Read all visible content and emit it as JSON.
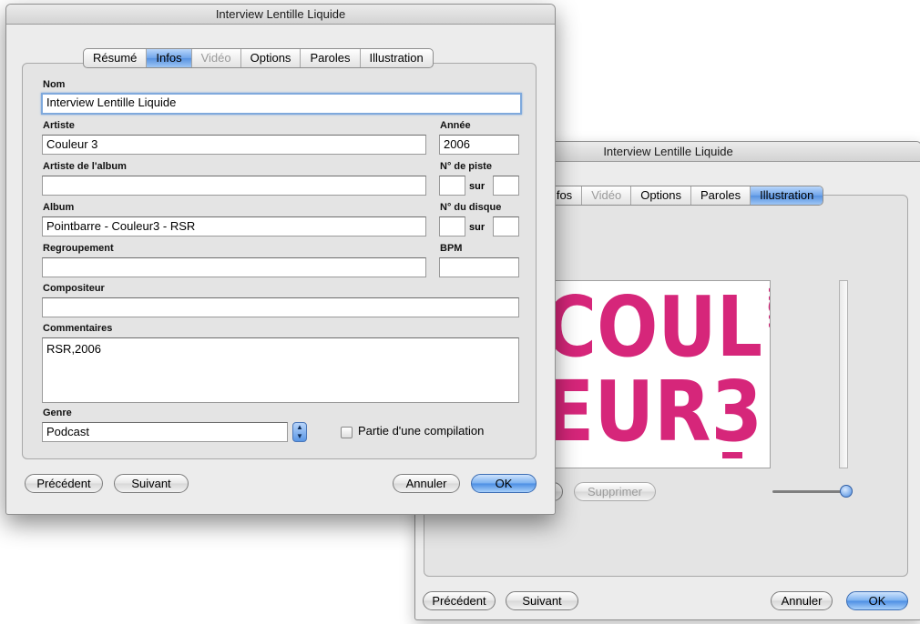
{
  "back_window": {
    "title": "Interview Lentille Liquide",
    "tabs": [
      {
        "label": "Infos",
        "state": "normal"
      },
      {
        "label": "Vidéo",
        "state": "disabled"
      },
      {
        "label": "Options",
        "state": "normal"
      },
      {
        "label": "Paroles",
        "state": "normal"
      },
      {
        "label": "Illustration",
        "state": "active"
      }
    ],
    "artwork_text": {
      "top": "COUL",
      "bottom": "EUR3",
      "side": "RSR"
    },
    "delete_label": "Supprimer",
    "prev_label": "Précédent",
    "next_label": "Suivant",
    "cancel_label": "Annuler",
    "ok_label": "OK"
  },
  "front_window": {
    "title": "Interview Lentille Liquide",
    "tabs": [
      {
        "label": "Résumé",
        "state": "normal"
      },
      {
        "label": "Infos",
        "state": "active"
      },
      {
        "label": "Vidéo",
        "state": "disabled"
      },
      {
        "label": "Options",
        "state": "normal"
      },
      {
        "label": "Paroles",
        "state": "normal"
      },
      {
        "label": "Illustration",
        "state": "normal"
      }
    ],
    "fields": {
      "name_label": "Nom",
      "name_value": "Interview Lentille Liquide",
      "artist_label": "Artiste",
      "artist_value": "Couleur 3",
      "year_label": "Année",
      "year_value": "2006",
      "album_artist_label": "Artiste de l'album",
      "album_artist_value": "",
      "track_label": "N° de piste",
      "track_value": "",
      "track_total_value": "",
      "album_label": "Album",
      "album_value": "Pointbarre - Couleur3 - RSR",
      "disc_label": "N° du disque",
      "disc_value": "",
      "disc_total_value": "",
      "of_label": "sur",
      "grouping_label": "Regroupement",
      "grouping_value": "",
      "bpm_label": "BPM",
      "bpm_value": "",
      "composer_label": "Compositeur",
      "composer_value": "",
      "comments_label": "Commentaires",
      "comments_value": "RSR,2006",
      "genre_label": "Genre",
      "genre_value": "Podcast",
      "compilation_label": "Partie d'une compilation",
      "compilation_checked": false
    },
    "prev_label": "Précédent",
    "next_label": "Suivant",
    "cancel_label": "Annuler",
    "ok_label": "OK"
  },
  "colors": {
    "accent": "#5791e0",
    "artwork_pink": "#d6267a"
  }
}
